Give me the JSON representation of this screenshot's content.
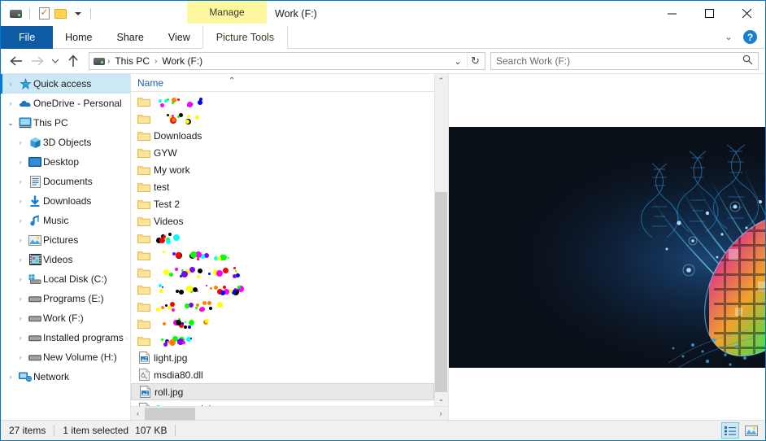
{
  "window": {
    "title": "Work (F:)",
    "contextual_tab_group": "Manage",
    "minimize": "–",
    "maximize": "▢",
    "close": "✕"
  },
  "quick_access_toolbar": {
    "items": [
      {
        "name": "drive-icon",
        "label": "Work (F:)"
      },
      {
        "name": "properties-icon",
        "label": "Properties"
      },
      {
        "name": "new-folder-icon",
        "label": "New folder"
      },
      {
        "name": "customize-dropdown-icon",
        "label": "Customize Quick Access Toolbar"
      }
    ]
  },
  "ribbon": {
    "tabs": [
      {
        "label": "File",
        "active": false,
        "style": "file"
      },
      {
        "label": "Home",
        "active": false,
        "style": "normal"
      },
      {
        "label": "Share",
        "active": false,
        "style": "normal"
      },
      {
        "label": "View",
        "active": false,
        "style": "normal"
      },
      {
        "label": "Picture Tools",
        "active": true,
        "style": "contextual"
      }
    ],
    "expand_label": "⌄",
    "help_label": "?"
  },
  "address": {
    "back_label": "←",
    "forward_label": "→",
    "recent_label": "⌄",
    "up_label": "↑",
    "breadcrumbs": [
      "This PC",
      "Work (F:)"
    ],
    "separator": "›",
    "dropdown_label": "⌄",
    "refresh_label": "↻"
  },
  "search": {
    "placeholder": "Search Work (F:)",
    "icon": "search-icon"
  },
  "sidebar": {
    "items": [
      {
        "label": "Quick access",
        "depth": 0,
        "expander": "›",
        "icon": "star-icon",
        "selected": true
      },
      {
        "label": "OneDrive - Personal",
        "depth": 0,
        "expander": "›",
        "icon": "cloud-icon",
        "selected": false
      },
      {
        "label": "This PC",
        "depth": 0,
        "expander": "⌄",
        "icon": "computer-icon",
        "selected": false,
        "expanded": true
      },
      {
        "label": "3D Objects",
        "depth": 1,
        "expander": "›",
        "icon": "3dobjects-icon",
        "selected": false
      },
      {
        "label": "Desktop",
        "depth": 1,
        "expander": "›",
        "icon": "desktop-icon",
        "selected": false
      },
      {
        "label": "Documents",
        "depth": 1,
        "expander": "›",
        "icon": "documents-icon",
        "selected": false
      },
      {
        "label": "Downloads",
        "depth": 1,
        "expander": "›",
        "icon": "downloads-icon",
        "selected": false
      },
      {
        "label": "Music",
        "depth": 1,
        "expander": "›",
        "icon": "music-icon",
        "selected": false
      },
      {
        "label": "Pictures",
        "depth": 1,
        "expander": "›",
        "icon": "pictures-icon",
        "selected": false
      },
      {
        "label": "Videos",
        "depth": 1,
        "expander": "›",
        "icon": "videos-icon",
        "selected": false
      },
      {
        "label": "Local Disk (C:)",
        "depth": 1,
        "expander": "›",
        "icon": "windows-drive-icon",
        "selected": false
      },
      {
        "label": "Programs (E:)",
        "depth": 1,
        "expander": "›",
        "icon": "drive-icon",
        "selected": false
      },
      {
        "label": "Work (F:)",
        "depth": 1,
        "expander": "›",
        "icon": "drive-icon",
        "selected": false
      },
      {
        "label": "Installed programs (",
        "depth": 1,
        "expander": "›",
        "icon": "drive-icon",
        "selected": false
      },
      {
        "label": "New Volume (H:)",
        "depth": 1,
        "expander": "›",
        "icon": "drive-icon",
        "selected": false
      },
      {
        "label": "Network",
        "depth": 0,
        "expander": "›",
        "icon": "network-icon",
        "selected": false
      }
    ]
  },
  "filelist": {
    "column_header": "Name",
    "sort_indicator": "⌃",
    "rows": [
      {
        "name": "",
        "redacted": true,
        "redact_width": 62,
        "icon": "folder-icon",
        "selected": false
      },
      {
        "name": "",
        "redacted": true,
        "redact_width": 60,
        "icon": "folder-icon",
        "selected": false
      },
      {
        "name": "Downloads",
        "redacted": false,
        "icon": "folder-icon",
        "selected": false
      },
      {
        "name": "GYW",
        "redacted": false,
        "icon": "folder-icon",
        "selected": false
      },
      {
        "name": "My work",
        "redacted": false,
        "icon": "folder-icon",
        "selected": false
      },
      {
        "name": "test",
        "redacted": false,
        "icon": "folder-icon",
        "selected": false
      },
      {
        "name": "Test 2",
        "redacted": false,
        "icon": "folder-icon",
        "selected": false
      },
      {
        "name": "Videos",
        "redacted": false,
        "icon": "folder-icon",
        "selected": false
      },
      {
        "name": "",
        "redacted": true,
        "redact_width": 40,
        "icon": "folder-icon",
        "selected": false
      },
      {
        "name": "",
        "redacted": true,
        "redact_width": 96,
        "icon": "folder-icon",
        "selected": false
      },
      {
        "name": "",
        "redacted": true,
        "redact_width": 120,
        "icon": "folder-icon",
        "selected": false
      },
      {
        "name": "",
        "redacted": true,
        "redact_width": 112,
        "icon": "folder-icon",
        "selected": false
      },
      {
        "name": "",
        "redacted": true,
        "redact_width": 86,
        "icon": "folder-icon",
        "selected": false
      },
      {
        "name": "",
        "redacted": true,
        "redact_width": 70,
        "icon": "folder-icon",
        "selected": false
      },
      {
        "name": "",
        "redacted": true,
        "redact_width": 58,
        "icon": "folder-icon",
        "selected": false
      },
      {
        "name": "light.jpg",
        "redacted": false,
        "icon": "image-file-icon",
        "selected": false
      },
      {
        "name": "msdia80.dll",
        "redacted": false,
        "icon": "dll-file-icon",
        "selected": false
      },
      {
        "name": "roll.jpg",
        "redacted": false,
        "icon": "image-file-icon",
        "selected": true
      },
      {
        "name": "txt",
        "redacted": true,
        "redact_width": 58,
        "icon": "text-file-icon",
        "selected": false
      }
    ],
    "vscroll": {
      "up": "⌃",
      "down": "⌄"
    },
    "hscroll": {
      "left": "‹",
      "right": "›"
    }
  },
  "preview": {
    "alt": "roll.jpg preview — DNA helix strands and light streaks converging on a colorful silicon wafer disc on a dark background",
    "background": "#0a1018",
    "accent_blue": "#2ec4ff"
  },
  "statusbar": {
    "item_count": "27 items",
    "selection": "1 item selected",
    "size": "107 KB",
    "details_view_label": "Details view",
    "large_icons_view_label": "Large icons view"
  },
  "colors": {
    "accent": "#0078d7",
    "file_tab": "#0d5ba5",
    "contextual": "#fdf7a0",
    "selection": "#cce8f4",
    "row_selection": "#e8e8e8",
    "folder": "#ffd34e"
  }
}
